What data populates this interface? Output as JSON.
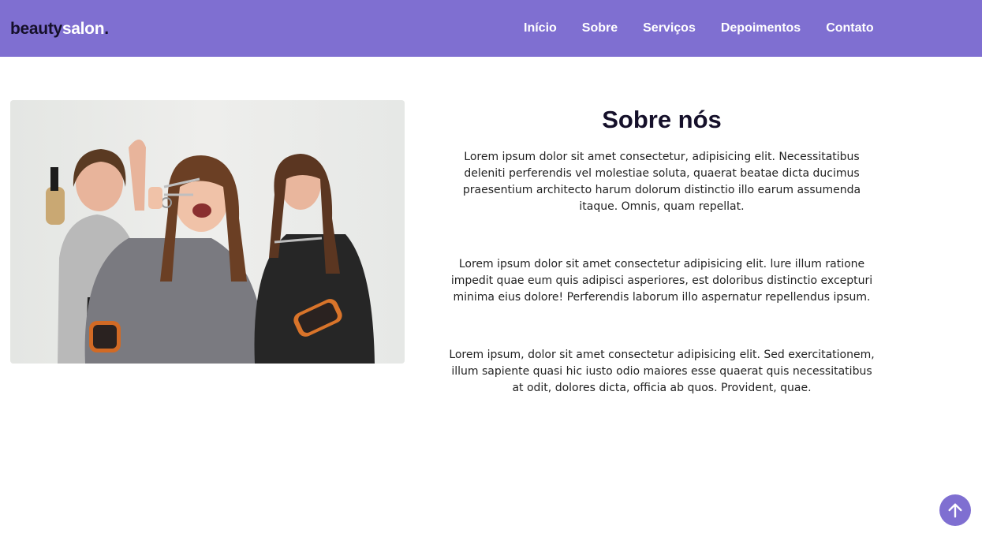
{
  "brand": {
    "part1": "beauty",
    "part2": "salon",
    "dot": "."
  },
  "nav": {
    "items": [
      "Início",
      "Sobre",
      "Serviços",
      "Depoimentos",
      "Contato"
    ]
  },
  "about": {
    "title": "Sobre nós",
    "paragraphs": [
      "Lorem ipsum dolor sit amet consectetur, adipisicing elit. Necessitatibus deleniti perferendis vel molestiae soluta, quaerat beatae dicta ducimus praesentium architecto harum dolorum distinctio illo earum assumenda itaque. Omnis, quam repellat.",
      "Lorem ipsum dolor sit amet consectetur adipisicing elit. lure illum ratione impedit quae eum quis adipisci asperiores, est doloribus distinctio excepturi minima eius dolore! Perferendis laborum illo aspernatur repellendus ipsum.",
      "Lorem ipsum, dolor sit amet consectetur adipisicing elit. Sed exercitationem, illum sapiente quasi hic iusto odio maiores esse quaerat quis necessitatibus at odit, dolores dicta, officia ab quos. Provident, quae."
    ]
  },
  "icons": {
    "back_to_top": "arrow-up-icon"
  },
  "colors": {
    "accent": "#7f6fd1",
    "dark": "#15102a",
    "text": "#222222"
  }
}
